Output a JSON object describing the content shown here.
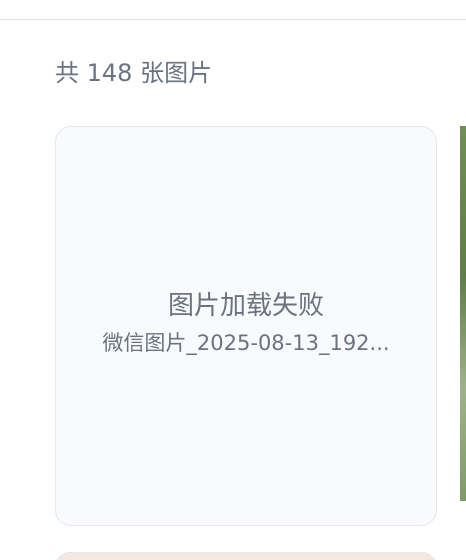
{
  "gallery": {
    "count_label": "共 148 张图片",
    "cards": [
      {
        "status": "图片加载失败",
        "filename": "微信图片_2025-08-13_192..."
      }
    ]
  },
  "colors": {
    "text_muted": "#6b7280",
    "card_border": "#e5e7eb",
    "card_background": "#f9fafb"
  }
}
